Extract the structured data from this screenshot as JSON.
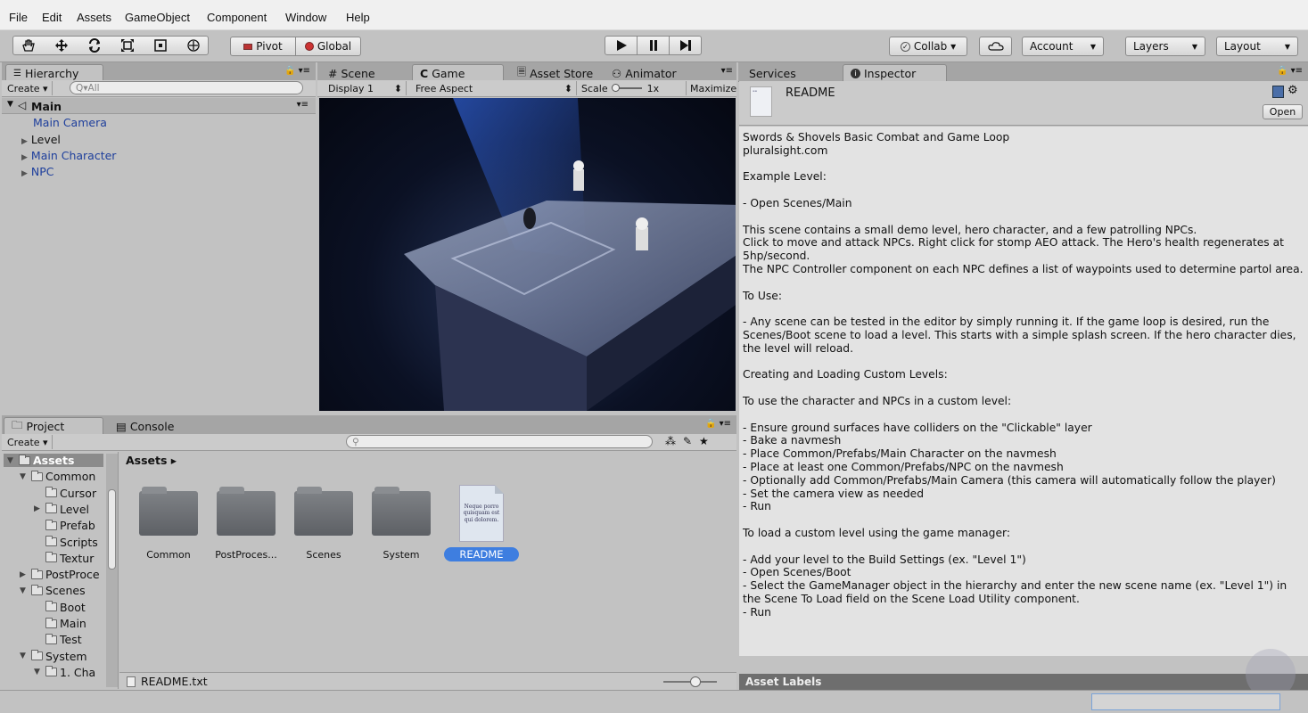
{
  "menu": [
    "File",
    "Edit",
    "Assets",
    "GameObject",
    "Component",
    "Window",
    "Help"
  ],
  "toolbar": {
    "pivot": "Pivot",
    "global": "Global",
    "collab": "Collab ▾",
    "account": "Account",
    "layers": "Layers",
    "layout": "Layout"
  },
  "hierarchy": {
    "tab": "Hierarchy",
    "create": "Create ▾",
    "search_placeholder": "Q▾All",
    "scene": "Main",
    "items": [
      "Main Camera",
      "Level",
      "Main Character",
      "NPC"
    ]
  },
  "center_tabs": [
    "Scene",
    "Game",
    "Asset Store",
    "Animator"
  ],
  "game_toolbar": {
    "display": "Display 1",
    "aspect": "Free Aspect",
    "scale_label": "Scale",
    "scale_value": "1x",
    "maximize": "Maximize"
  },
  "right_tabs": [
    "Services",
    "Inspector"
  ],
  "inspector": {
    "asset_name": "README",
    "open_button": "Open",
    "body": "Swords & Shovels Basic Combat and Game Loop\npluralsight.com\n\nExample Level:\n\n- Open Scenes/Main\n\nThis scene contains a small demo level, hero character, and a few patrolling NPCs.\nClick to move and attack NPCs. Right click for stomp AEO attack. The Hero's health regenerates at 5hp/second.\nThe NPC Controller component on each NPC defines a list of waypoints used to determine partol area.\n\nTo Use:\n\n- Any scene can be tested in the editor by simply running it. If the game loop is desired, run the Scenes/Boot scene to load a level. This starts with a simple splash screen. If the hero character dies, the level will reload.\n\nCreating and Loading Custom Levels:\n\nTo use the character and NPCs in a custom level:\n\n- Ensure ground surfaces have colliders on the \"Clickable\" layer\n- Bake a navmesh\n- Place Common/Prefabs/Main Character on the navmesh\n- Place at least one Common/Prefabs/NPC on the navmesh\n- Optionally add Common/Prefabs/Main Camera (this camera will automatically follow the player)\n- Set the camera view as needed\n- Run\n\nTo load a custom level using the game manager:\n\n- Add your level to the Build Settings (ex. \"Level 1\")\n- Open Scenes/Boot\n- Select the GameManager object in the hierarchy and enter the new scene name (ex. \"Level 1\") in the Scene To Load field on the Scene Load Utility component.\n- Run",
    "asset_labels": "Asset Labels"
  },
  "project": {
    "tabs": [
      "Project",
      "Console"
    ],
    "create": "Create ▾",
    "breadcrumb": "Assets ▸",
    "tree": [
      {
        "label": "Assets",
        "indent": 0,
        "arrow": "▼"
      },
      {
        "label": "Common",
        "indent": 1,
        "arrow": "▼"
      },
      {
        "label": "Cursor",
        "indent": 2,
        "arrow": ""
      },
      {
        "label": "Level",
        "indent": 2,
        "arrow": "▶"
      },
      {
        "label": "Prefab",
        "indent": 2,
        "arrow": ""
      },
      {
        "label": "Scripts",
        "indent": 2,
        "arrow": ""
      },
      {
        "label": "Textur",
        "indent": 2,
        "arrow": ""
      },
      {
        "label": "PostProce",
        "indent": 1,
        "arrow": "▶"
      },
      {
        "label": "Scenes",
        "indent": 1,
        "arrow": "▼"
      },
      {
        "label": "Boot",
        "indent": 2,
        "arrow": ""
      },
      {
        "label": "Main",
        "indent": 2,
        "arrow": ""
      },
      {
        "label": "Test",
        "indent": 2,
        "arrow": ""
      },
      {
        "label": "System",
        "indent": 1,
        "arrow": "▼"
      },
      {
        "label": "1. Cha",
        "indent": 2,
        "arrow": "▼"
      }
    ],
    "assets": [
      "Common",
      "PostProces...",
      "Scenes",
      "System",
      "README"
    ],
    "readme_preview": "Neque porro quisquam est qui dolorem.",
    "selected_path": "README.txt"
  }
}
